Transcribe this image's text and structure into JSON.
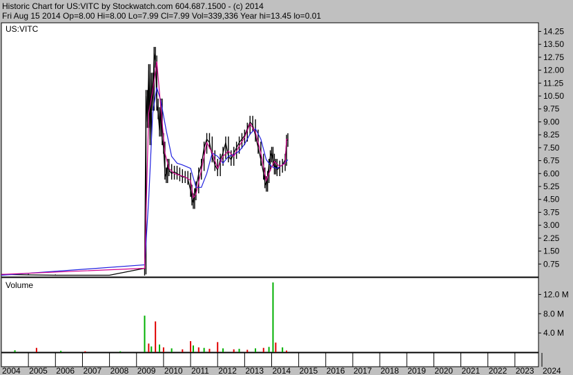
{
  "header": {
    "line1": "Historic Chart for US:VITC  by Stockwatch.com 604.687.1500 - (c) 2014",
    "line2": "Fri Aug 15 2014   Op=8.00  Hi=8.00  Lo=7.99  Cl=7.99  Vol=339,336   Year hi=13.45  lo=0.01"
  },
  "colors": {
    "background": "#c0c0c0",
    "plot": "#ffffff",
    "price_bars": "#000000",
    "short_ma": "#d0008a",
    "long_ma": "#2020e0",
    "volume_up": "#00b000",
    "volume_down": "#e00000"
  },
  "chart_data": [
    {
      "type": "line",
      "legend_label": "US:VITC",
      "ylim": [
        0,
        14.75
      ],
      "y_ticks": [
        "14.25",
        "13.50",
        "12.75",
        "12.00",
        "11.25",
        "10.50",
        "9.75",
        "9.00",
        "8.25",
        "7.50",
        "6.75",
        "6.00",
        "5.25",
        "4.50",
        "3.75",
        "3.00",
        "2.25",
        "1.50",
        "0.75"
      ],
      "y_tick_values": [
        14.25,
        13.5,
        12.75,
        12.0,
        11.25,
        10.5,
        9.75,
        9.0,
        8.25,
        7.5,
        6.75,
        6.0,
        5.25,
        4.5,
        3.75,
        3.0,
        2.25,
        1.5,
        0.75
      ],
      "x_ticks": [
        "2004",
        "2005",
        "2006",
        "2007",
        "2008",
        "2009",
        "2010",
        "2011",
        "2012",
        "2013",
        "2014",
        "2015",
        "2016",
        "2017",
        "2018",
        "2019",
        "2020",
        "2021",
        "2022",
        "2023",
        "2024"
      ],
      "price": {
        "x": [
          2004.0,
          2005.0,
          2006.0,
          2007.0,
          2008.0,
          2009.3,
          2009.35,
          2009.4,
          2009.45,
          2009.5,
          2009.55,
          2009.6,
          2009.65,
          2009.7,
          2009.75,
          2009.8,
          2009.85,
          2009.9,
          2009.95,
          2010.0,
          2010.05,
          2010.1,
          2010.15,
          2010.2,
          2010.3,
          2010.4,
          2010.5,
          2010.6,
          2010.7,
          2010.8,
          2010.9,
          2011.0,
          2011.05,
          2011.1,
          2011.15,
          2011.2,
          2011.3,
          2011.4,
          2011.5,
          2011.6,
          2011.7,
          2011.8,
          2011.9,
          2012.0,
          2012.1,
          2012.2,
          2012.3,
          2012.4,
          2012.5,
          2012.6,
          2012.7,
          2012.8,
          2012.9,
          2013.0,
          2013.1,
          2013.2,
          2013.3,
          2013.4,
          2013.5,
          2013.6,
          2013.7,
          2013.75,
          2013.8,
          2013.85,
          2013.9,
          2013.95,
          2014.0,
          2014.05,
          2014.1,
          2014.15,
          2014.2,
          2014.3,
          2014.4,
          2014.5,
          2014.55,
          2014.6
        ],
        "y": [
          0.15,
          0.12,
          0.1,
          0.1,
          0.1,
          0.5,
          10.5,
          9.0,
          12.0,
          8.0,
          11.5,
          10.0,
          13.0,
          12.5,
          10.0,
          9.5,
          8.5,
          10.0,
          8.0,
          7.5,
          6.0,
          5.8,
          6.5,
          6.2,
          6.0,
          6.1,
          6.0,
          5.9,
          5.8,
          5.8,
          5.7,
          5.0,
          4.5,
          4.3,
          4.8,
          5.2,
          6.0,
          6.5,
          7.5,
          8.0,
          7.8,
          7.0,
          6.5,
          6.2,
          6.8,
          7.2,
          7.8,
          7.0,
          6.8,
          7.2,
          7.5,
          7.8,
          8.0,
          8.2,
          8.6,
          9.0,
          8.8,
          8.2,
          7.5,
          6.8,
          6.0,
          5.5,
          5.3,
          5.8,
          6.5,
          7.0,
          7.2,
          6.8,
          6.3,
          6.5,
          6.2,
          6.4,
          6.5,
          6.8,
          7.9,
          7.99
        ]
      },
      "short_ma": {
        "x": [
          2004.0,
          2009.3,
          2009.45,
          2009.6,
          2009.75,
          2009.9,
          2010.05,
          2010.2,
          2010.4,
          2010.6,
          2010.8,
          2011.0,
          2011.1,
          2011.2,
          2011.4,
          2011.6,
          2011.8,
          2012.0,
          2012.2,
          2012.4,
          2012.6,
          2012.8,
          2013.0,
          2013.2,
          2013.4,
          2013.6,
          2013.8,
          2013.95,
          2014.1,
          2014.3,
          2014.5,
          2014.55,
          2014.6
        ],
        "y": [
          0.15,
          0.5,
          9.5,
          10.8,
          12.5,
          9.8,
          7.2,
          6.3,
          6.0,
          5.9,
          5.8,
          5.6,
          4.6,
          4.8,
          6.2,
          7.8,
          7.2,
          6.3,
          7.0,
          7.3,
          7.0,
          7.6,
          8.1,
          8.9,
          8.4,
          7.2,
          5.6,
          6.2,
          6.7,
          6.4,
          6.6,
          7.99,
          7.99
        ]
      },
      "long_ma": {
        "x": [
          2004.0,
          2009.3,
          2009.45,
          2009.6,
          2009.75,
          2009.9,
          2010.1,
          2010.3,
          2010.5,
          2010.7,
          2011.0,
          2011.2,
          2011.4,
          2011.6,
          2011.8,
          2012.0,
          2012.2,
          2012.4,
          2012.6,
          2012.8,
          2013.0,
          2013.2,
          2013.4,
          2013.6,
          2013.8,
          2014.0,
          2014.2,
          2014.4,
          2014.6
        ],
        "y": [
          0.1,
          0.7,
          4.5,
          9.5,
          11.0,
          10.2,
          8.5,
          7.0,
          6.6,
          6.5,
          6.3,
          5.2,
          5.2,
          6.0,
          7.2,
          7.0,
          6.6,
          7.0,
          7.1,
          7.3,
          7.7,
          8.3,
          8.6,
          8.0,
          6.8,
          6.4,
          6.3,
          6.5,
          6.8
        ]
      }
    },
    {
      "type": "bar",
      "legend_label": "Volume",
      "ylim": [
        0,
        15.5
      ],
      "y_ticks": [
        "12.0 M",
        "8.0 M",
        "4.0 M"
      ],
      "y_tick_values": [
        12.0,
        8.0,
        4.0
      ],
      "bars": [
        {
          "x": 2004.5,
          "v": 0.4,
          "up": true
        },
        {
          "x": 2005.3,
          "v": 0.9,
          "up": false
        },
        {
          "x": 2006.2,
          "v": 0.3,
          "up": true
        },
        {
          "x": 2007.1,
          "v": 0.2,
          "up": false
        },
        {
          "x": 2008.4,
          "v": 0.2,
          "up": true
        },
        {
          "x": 2009.3,
          "v": 7.6,
          "up": true
        },
        {
          "x": 2009.45,
          "v": 1.8,
          "up": false
        },
        {
          "x": 2009.55,
          "v": 1.2,
          "up": true
        },
        {
          "x": 2009.7,
          "v": 6.4,
          "up": false
        },
        {
          "x": 2009.85,
          "v": 1.6,
          "up": true
        },
        {
          "x": 2010.0,
          "v": 1.0,
          "up": false
        },
        {
          "x": 2010.3,
          "v": 0.8,
          "up": true
        },
        {
          "x": 2010.7,
          "v": 0.6,
          "up": false
        },
        {
          "x": 2011.0,
          "v": 2.3,
          "up": false
        },
        {
          "x": 2011.1,
          "v": 1.4,
          "up": true
        },
        {
          "x": 2011.3,
          "v": 1.0,
          "up": false
        },
        {
          "x": 2011.5,
          "v": 0.9,
          "up": true
        },
        {
          "x": 2011.7,
          "v": 0.7,
          "up": false
        },
        {
          "x": 2012.0,
          "v": 2.1,
          "up": false
        },
        {
          "x": 2012.2,
          "v": 0.8,
          "up": true
        },
        {
          "x": 2012.6,
          "v": 0.6,
          "up": false
        },
        {
          "x": 2012.8,
          "v": 0.7,
          "up": true
        },
        {
          "x": 2013.1,
          "v": 0.5,
          "up": false
        },
        {
          "x": 2013.4,
          "v": 0.8,
          "up": true
        },
        {
          "x": 2013.7,
          "v": 0.9,
          "up": false
        },
        {
          "x": 2013.9,
          "v": 1.1,
          "up": true
        },
        {
          "x": 2014.05,
          "v": 14.5,
          "up": true
        },
        {
          "x": 2014.15,
          "v": 2.0,
          "up": false
        },
        {
          "x": 2014.4,
          "v": 1.0,
          "up": true
        },
        {
          "x": 2014.55,
          "v": 0.34,
          "up": false
        }
      ]
    }
  ]
}
